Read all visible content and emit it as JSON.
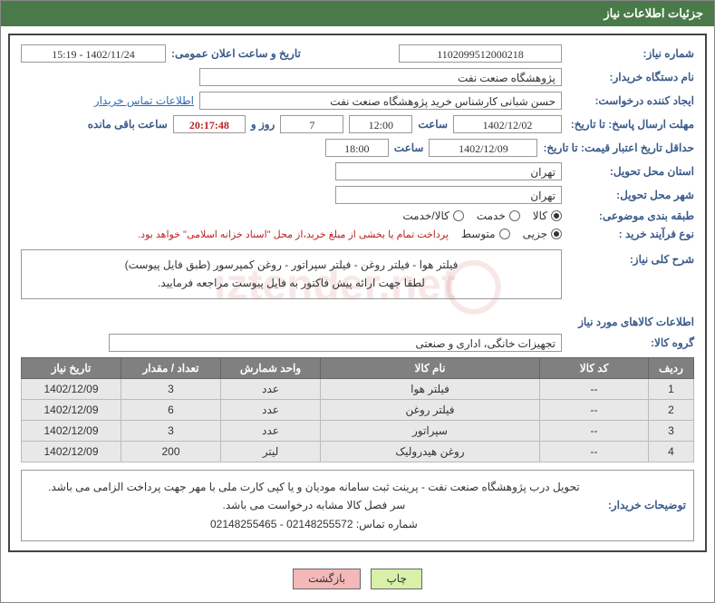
{
  "header": {
    "title": "جزئیات اطلاعات نیاز"
  },
  "need_number": {
    "label": "شماره نیاز:",
    "value": "1102099512000218"
  },
  "announce": {
    "label": "تاریخ و ساعت اعلان عمومی:",
    "value": "1402/11/24 - 15:19"
  },
  "buyer_org": {
    "label": "نام دستگاه خریدار:",
    "value": "پژوهشگاه صنعت نفت"
  },
  "requester": {
    "label": "ایجاد کننده درخواست:",
    "value": "حسن شبانی کارشناس خرید پژوهشگاه صنعت نفت",
    "contact_link": "اطلاعات تماس خریدار"
  },
  "reply_deadline": {
    "label": "مهلت ارسال پاسخ: تا تاریخ:",
    "date": "1402/12/02",
    "time_label": "ساعت",
    "time": "12:00",
    "days": "7",
    "days_label": "روز و",
    "countdown": "20:17:48",
    "remaining_label": "ساعت باقی مانده"
  },
  "price_validity": {
    "label": "حداقل تاریخ اعتبار قیمت: تا تاریخ:",
    "date": "1402/12/09",
    "time_label": "ساعت",
    "time": "18:00"
  },
  "delivery_province": {
    "label": "استان محل تحویل:",
    "value": "تهران"
  },
  "delivery_city": {
    "label": "شهر محل تحویل:",
    "value": "تهران"
  },
  "subject_class": {
    "label": "طبقه بندی موضوعی:",
    "opt1": "کالا",
    "opt2": "خدمت",
    "opt3": "کالا/خدمت"
  },
  "purchase_type": {
    "label": "نوع فرآیند خرید :",
    "opt1": "جزیی",
    "opt2": "متوسط",
    "note": "پرداخت تمام یا بخشی از مبلغ خرید،از محل \"اسناد خزانه اسلامی\" خواهد بود."
  },
  "general_desc": {
    "label": "شرح کلی نیاز:",
    "line1": "فیلتر هوا - فیلتر روغن - فیلتر سپراتور - روغن کمپرسور   (طبق فایل پیوست)",
    "line2": "لطفا جهت ارائه پیش فاکتور به فایل پیوست مراجعه فرمایید."
  },
  "items_section_title": "اطلاعات کالاهای مورد نیاز",
  "group": {
    "label": "گروه کالا:",
    "value": "تجهیزات خانگی، اداری و صنعتی"
  },
  "table": {
    "headers": {
      "row": "ردیف",
      "code": "کد کالا",
      "name": "نام کالا",
      "unit": "واحد شمارش",
      "qty": "تعداد / مقدار",
      "date": "تاریخ نیاز"
    },
    "rows": [
      {
        "row": "1",
        "code": "--",
        "name": "فیلتر هوا",
        "unit": "عدد",
        "qty": "3",
        "date": "1402/12/09"
      },
      {
        "row": "2",
        "code": "--",
        "name": "فیلتر روغن",
        "unit": "عدد",
        "qty": "6",
        "date": "1402/12/09"
      },
      {
        "row": "3",
        "code": "--",
        "name": "سپراتور",
        "unit": "عدد",
        "qty": "3",
        "date": "1402/12/09"
      },
      {
        "row": "4",
        "code": "--",
        "name": "روغن هیدرولیک",
        "unit": "لیتر",
        "qty": "200",
        "date": "1402/12/09"
      }
    ]
  },
  "buyer_notes": {
    "label": "توضیحات خریدار:",
    "line1": "تحویل درب پژوهشگاه صنعت نفت - پرینت ثبت سامانه مودیان و یا کپی کارت ملی با مهر جهت پرداخت الزامی می باشد.",
    "line2": "سر فصل کالا مشابه درخواست می باشد.",
    "line3": "شماره تماس: 02148255572 - 02148255465"
  },
  "buttons": {
    "print": "چاپ",
    "back": "بازگشت"
  },
  "watermark": "iztender.net"
}
